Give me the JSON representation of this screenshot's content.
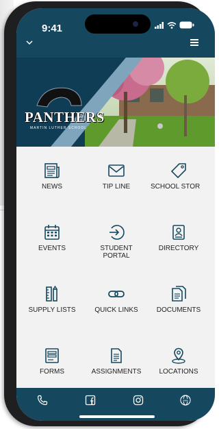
{
  "status": {
    "time": "9:41"
  },
  "hero": {
    "logo_text": "PANTHERS",
    "logo_subtext": "MARTIN LUTHER SCHOOL"
  },
  "tiles": [
    {
      "label": "NEWS",
      "icon": "newspaper-icon"
    },
    {
      "label": "TIP LINE",
      "icon": "envelope-icon"
    },
    {
      "label": "SCHOOL STOR",
      "icon": "tag-icon"
    },
    {
      "label": "EVENTS",
      "icon": "calendar-icon"
    },
    {
      "label": "STUDENT PORTAL",
      "label_line1": "STUDENT",
      "label_line2": "PORTAL",
      "icon": "login-arrow-icon"
    },
    {
      "label": "DIRECTORY",
      "icon": "contact-card-icon"
    },
    {
      "label": "SUPPLY LISTS",
      "icon": "ruler-pencil-icon"
    },
    {
      "label": "QUICK LINKS",
      "icon": "link-icon"
    },
    {
      "label": "DOCUMENTS",
      "icon": "documents-icon"
    },
    {
      "label": "FORMS",
      "icon": "form-icon"
    },
    {
      "label": "ASSIGNMENTS",
      "icon": "assignment-icon"
    },
    {
      "label": "LOCATIONS",
      "icon": "map-pin-icon"
    }
  ],
  "bottom_bar": [
    "phone-icon",
    "facebook-icon",
    "instagram-icon",
    "website-icon"
  ],
  "colors": {
    "brand": "#15475e",
    "hero_accent": "#7fa5bc",
    "background": "#f2f2f2"
  }
}
